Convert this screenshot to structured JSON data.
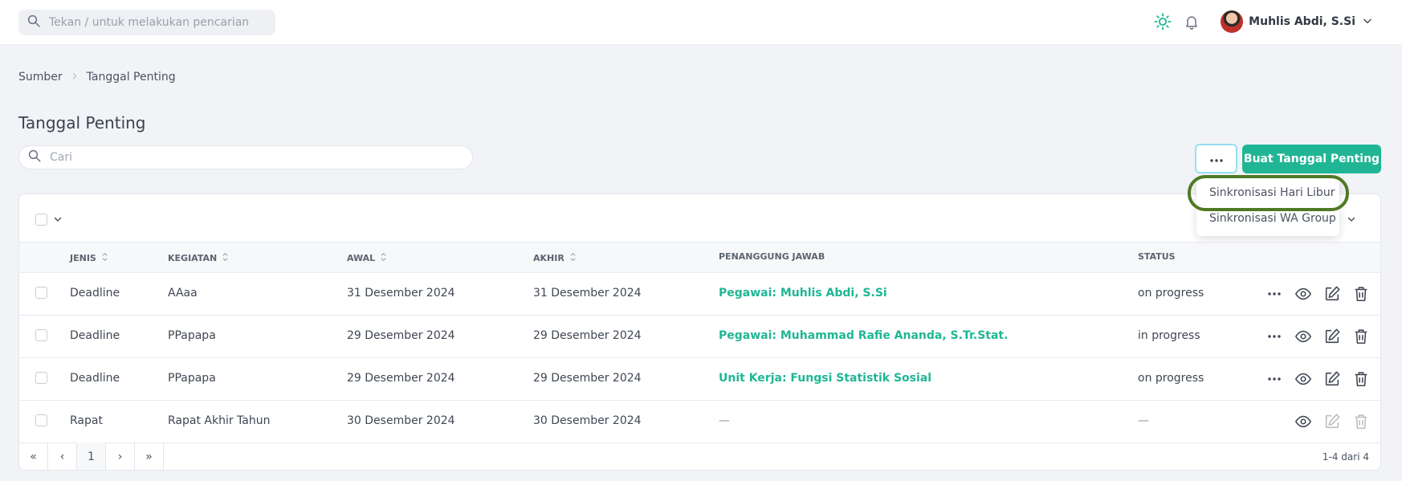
{
  "topbar": {
    "search_placeholder": "Tekan / untuk melakukan pencarian",
    "user_name": "Muhlis Abdi, S.Si",
    "icons": [
      "search-icon",
      "sun-icon",
      "bell-icon",
      "avatar",
      "chevron-down-icon"
    ]
  },
  "breadcrumb": {
    "items": [
      "Sumber",
      "Tanggal Penting"
    ]
  },
  "page": {
    "title": "Tanggal Penting"
  },
  "toolbar": {
    "search_placeholder": "Cari",
    "more_label": "···",
    "create_label": "Buat Tanggal Penting",
    "accent": "#20b695"
  },
  "dropdown": {
    "items": [
      "Sinkronisasi Hari Libur",
      "Sinkronisasi WA Group"
    ],
    "highlighted": "Sinkronisasi Hari Libur",
    "highlight_color": "#4e7a23"
  },
  "table": {
    "columns": [
      "JENIS",
      "KEGIATAN",
      "AWAL",
      "AKHIR",
      "PENANGGUNG JAWAB",
      "STATUS"
    ],
    "rows": [
      {
        "jenis": "Deadline",
        "kegiatan": "AAaa",
        "awal": "31 Desember 2024",
        "akhir": "31 Desember 2024",
        "penanggung_jawab": "Pegawai: Muhlis Abdi, S.Si",
        "status": "on progress",
        "editable": true
      },
      {
        "jenis": "Deadline",
        "kegiatan": "PPapapa",
        "awal": "29 Desember 2024",
        "akhir": "29 Desember 2024",
        "penanggung_jawab": "Pegawai: Muhammad Rafie Ananda, S.Tr.Stat.",
        "status": "in progress",
        "editable": true
      },
      {
        "jenis": "Deadline",
        "kegiatan": "PPapapa",
        "awal": "29 Desember 2024",
        "akhir": "29 Desember 2024",
        "penanggung_jawab": "Unit Kerja: Fungsi Statistik Sosial",
        "status": "on progress",
        "editable": true
      },
      {
        "jenis": "Rapat",
        "kegiatan": "Rapat Akhir Tahun",
        "awal": "30 Desember 2024",
        "akhir": "30 Desember 2024",
        "penanggung_jawab": "—",
        "status": "—",
        "editable": false
      }
    ]
  },
  "pagination": {
    "first": "«",
    "prev": "‹",
    "current": "1",
    "next": "›",
    "last": "»",
    "summary": "1-4 dari 4"
  }
}
